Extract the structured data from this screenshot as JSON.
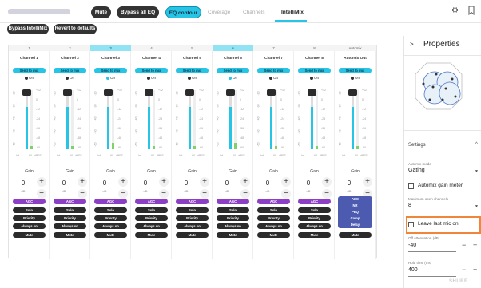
{
  "header": {
    "buttons": {
      "mute": "Mute",
      "bypass_all_eq": "Bypass all EQ",
      "eq_contour": "EQ contour"
    },
    "tabs": [
      "Coverage",
      "Channels",
      "IntelliMix"
    ],
    "active_tab": "IntelliMix",
    "accent": "#27c4e6"
  },
  "action_bar": {
    "bypass_intellimix": "Bypass IntelliMix",
    "revert_to_defaults": "Revert to defaults"
  },
  "mixer": {
    "send_label": "Send to mix",
    "on_label": "On",
    "gain_label": "Gain",
    "gain_unit": "dB",
    "scale_right": [
      "+12",
      "0",
      "-12",
      "-24",
      "-36",
      "-48",
      "-60"
    ],
    "scale_left": [
      "-20",
      "-30",
      "-40",
      "-50",
      "-60"
    ],
    "tick_labels": [
      "-Inf",
      "-60",
      "dBFS"
    ],
    "channels": [
      {
        "num": "1",
        "name": "Channel 1",
        "gain": "0",
        "selected": false,
        "fader_level": 0.72
      },
      {
        "num": "2",
        "name": "Channel 2",
        "gain": "0",
        "selected": false,
        "fader_level": 0.72
      },
      {
        "num": "3",
        "name": "Channel 3",
        "gain": "0",
        "selected": true,
        "fader_level": 0.72
      },
      {
        "num": "4",
        "name": "Channel 4",
        "gain": "0",
        "selected": false,
        "fader_level": 0.72
      },
      {
        "num": "5",
        "name": "Channel 5",
        "gain": "0",
        "selected": false,
        "fader_level": 0.72
      },
      {
        "num": "6",
        "name": "Channel 6",
        "gain": "0",
        "selected": true,
        "fader_level": 0.72
      },
      {
        "num": "7",
        "name": "Channel 7",
        "gain": "0",
        "selected": false,
        "fader_level": 0.72
      },
      {
        "num": "8",
        "name": "Channel 8",
        "gain": "0",
        "selected": false,
        "fader_level": 0.72
      },
      {
        "num": "Automix",
        "name": "Automix Out",
        "gain": "0",
        "selected": false,
        "fader_level": 0.72
      }
    ],
    "modes": {
      "agc": "AGC",
      "solo": "Solo",
      "priority": "Priority",
      "always_on": "Always on",
      "mute": "Mute"
    },
    "automix_modes": [
      "AEC",
      "NR",
      "PEQ",
      "Comp",
      "Delay"
    ]
  },
  "properties": {
    "title": "Properties",
    "settings_title": "Settings",
    "automix_mode_label": "Automix mode",
    "automix_mode_value": "Gating",
    "automix_gain_meter": "Automix gain meter",
    "max_open_channels_label": "Maximum open channels",
    "max_open_channels_value": "8",
    "leave_last_mic_on": "Leave last mic on",
    "off_attenuation_label": "Off attenuation (dB)",
    "off_attenuation_value": "-40",
    "hold_time_label": "Hold time (ms)",
    "hold_time_value": "400",
    "highlight_color": "#f0863a"
  },
  "watermark": "SHURE"
}
